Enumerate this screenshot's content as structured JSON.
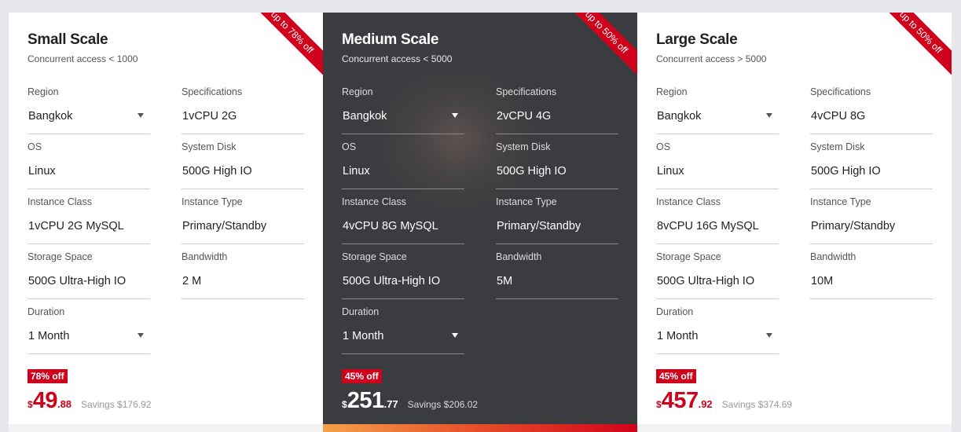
{
  "labels": {
    "region": "Region",
    "specifications": "Specifications",
    "os": "OS",
    "system_disk": "System Disk",
    "instance_class": "Instance Class",
    "instance_type": "Instance Type",
    "storage_space": "Storage Space",
    "bandwidth": "Bandwidth",
    "duration": "Duration",
    "savings": "Savings"
  },
  "colors": {
    "accent": "#d0021b",
    "dark_card": "#3a3c3f",
    "background": "#e6e7eb"
  },
  "plans": [
    {
      "title": "Small Scale",
      "subtitle": "Concurrent access < 1000",
      "ribbon": "up to 78% off",
      "region": "Bangkok",
      "specifications": "1vCPU 2G",
      "os": "Linux",
      "system_disk": "500G High IO",
      "instance_class": "1vCPU 2G MySQL",
      "instance_type": "Primary/Standby",
      "storage_space": "500G Ultra-High IO",
      "bandwidth": "2 M",
      "duration": "1 Month",
      "discount_badge": "78% off",
      "currency": "$",
      "price_int": "49",
      "price_dec": ".88",
      "savings": "Savings $176.92"
    },
    {
      "title": "Medium Scale",
      "subtitle": "Concurrent access < 5000",
      "ribbon": "up to 50% off",
      "region": "Bangkok",
      "specifications": "2vCPU 4G",
      "os": "Linux",
      "system_disk": "500G High IO",
      "instance_class": "4vCPU 8G MySQL",
      "instance_type": "Primary/Standby",
      "storage_space": "500G Ultra-High IO",
      "bandwidth": "5M",
      "duration": "1 Month",
      "discount_badge": "45% off",
      "currency": "$",
      "price_int": "251",
      "price_dec": ".77",
      "savings": "Savings $206.02"
    },
    {
      "title": "Large Scale",
      "subtitle": "Concurrent access > 5000",
      "ribbon": "up to 50% off",
      "region": "Bangkok",
      "specifications": "4vCPU 8G",
      "os": "Linux",
      "system_disk": "500G High IO",
      "instance_class": "8vCPU 16G MySQL",
      "instance_type": "Primary/Standby",
      "storage_space": "500G Ultra-High IO",
      "bandwidth": "10M",
      "duration": "1 Month",
      "discount_badge": "45% off",
      "currency": "$",
      "price_int": "457",
      "price_dec": ".92",
      "savings": "Savings $374.69"
    }
  ]
}
